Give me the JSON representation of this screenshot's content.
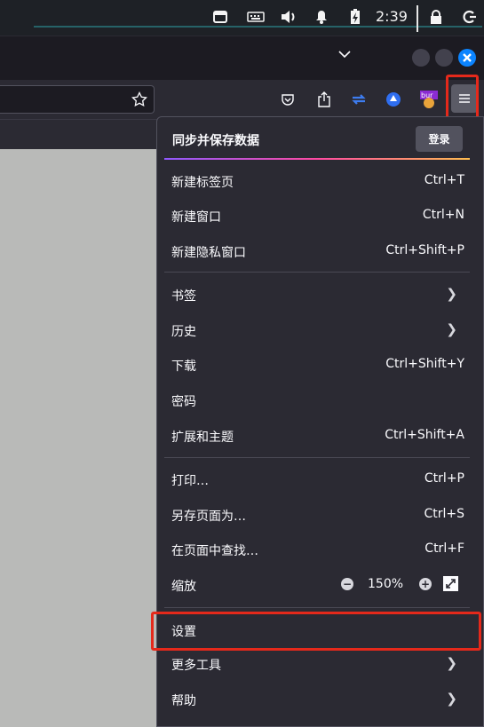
{
  "systray": {
    "clock": "2:39"
  },
  "toolbar": {
    "extension_label": "bur"
  },
  "menu": {
    "sync": {
      "label": "同步并保存数据",
      "login_button": "登录"
    },
    "items": [
      {
        "label": "新建标签页",
        "shortcut": "Ctrl+T"
      },
      {
        "label": "新建窗口",
        "shortcut": "Ctrl+N"
      },
      {
        "label": "新建隐私窗口",
        "shortcut": "Ctrl+Shift+P"
      },
      {
        "label": "书签",
        "shortcut": ""
      },
      {
        "label": "历史",
        "shortcut": ""
      },
      {
        "label": "下载",
        "shortcut": "Ctrl+Shift+Y"
      },
      {
        "label": "密码",
        "shortcut": ""
      },
      {
        "label": "扩展和主题",
        "shortcut": "Ctrl+Shift+A"
      },
      {
        "label": "打印…",
        "shortcut": "Ctrl+P"
      },
      {
        "label": "另存页面为…",
        "shortcut": "Ctrl+S"
      },
      {
        "label": "在页面中查找…",
        "shortcut": "Ctrl+F"
      },
      {
        "label": "缩放",
        "shortcut": ""
      },
      {
        "label": "设置",
        "shortcut": ""
      },
      {
        "label": "更多工具",
        "shortcut": ""
      },
      {
        "label": "帮助",
        "shortcut": ""
      }
    ],
    "zoom": {
      "minus": "−",
      "value": "150%",
      "plus": "+"
    }
  },
  "colors": {
    "highlight": "#e5291b",
    "panel_bg": "#2b2a33",
    "content_bg": "#b9bab8",
    "window_close": "#0b84ff"
  },
  "icons": [
    "window-icon",
    "keyboard-icon",
    "volume-icon",
    "bell-icon",
    "battery-icon",
    "lock-icon",
    "power-icon",
    "chevron-down-icon",
    "close-icon",
    "star-icon",
    "pocket-icon",
    "share-icon",
    "sync-icon",
    "vpn-icon",
    "hamburger-menu-icon",
    "chevron-right-icon",
    "zoom-minus-icon",
    "zoom-plus-icon",
    "fullscreen-icon"
  ]
}
